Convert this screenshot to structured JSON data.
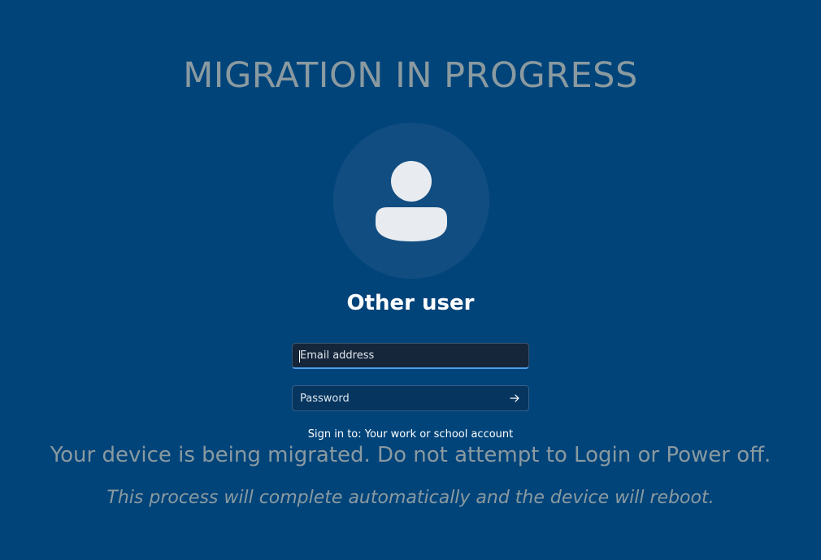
{
  "banner": {
    "title": "MIGRATION IN PROGRESS"
  },
  "user": {
    "avatar_icon": "user-silhouette-icon",
    "name": "Other user"
  },
  "signin": {
    "email_placeholder": "Email address",
    "email_value": "",
    "password_placeholder": "Password",
    "password_value": "",
    "submit_icon": "arrow-right-icon",
    "target_label": "Sign in to: Your work or school account"
  },
  "messages": {
    "warning": "Your device is being migrated. Do not attempt to Login or Power off.",
    "notice": "This process will complete automatically and the device will reboot."
  },
  "colors": {
    "background": "#01447a",
    "avatar_circle": "#114d81",
    "overlay_text": "#8a9aa0",
    "focus_accent": "#4a9fe8"
  }
}
